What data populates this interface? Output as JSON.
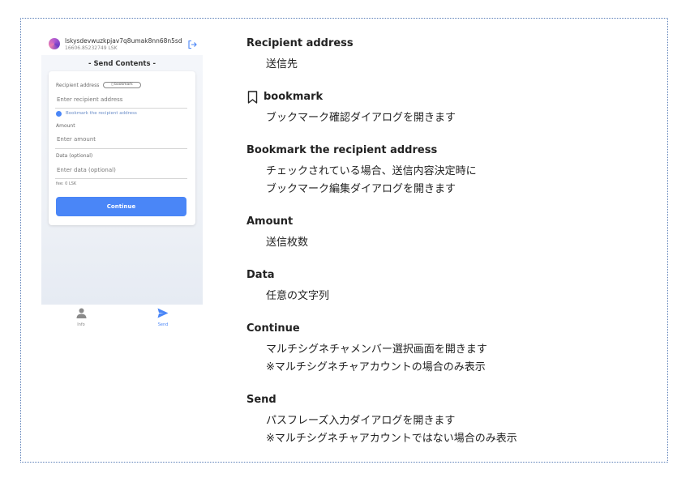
{
  "phone": {
    "address": "lskysdevwuzkpjav7q8umak8nn68n5sd6…",
    "balance": "16606.85232749 LSK",
    "title": "- Send Contents -",
    "recipient_label": "Recipient address",
    "bookmark_pill": "bookmark",
    "recipient_placeholder": "Enter recipient address",
    "bookmark_checkbox_label": "Bookmark the recipient address",
    "amount_label": "Amount",
    "amount_placeholder": "Enter amount",
    "data_label": "Data (optional)",
    "data_placeholder": "Enter data (optional)",
    "fee": "fee: 0 LSK",
    "continue_label": "Continue",
    "nav": [
      {
        "label": "Info",
        "icon": "person-icon",
        "active": false
      },
      {
        "label": "Send",
        "icon": "send-icon",
        "active": true
      }
    ]
  },
  "items": [
    {
      "term": "Recipient address",
      "lines": [
        "送信先"
      ]
    },
    {
      "term": "bookmark",
      "icon": "bookmark-icon",
      "lines": [
        "ブックマーク確認ダイアログを開きます"
      ]
    },
    {
      "term": "Bookmark the recipient address",
      "lines": [
        "チェックされている場合、送信内容決定時に",
        "ブックマーク編集ダイアログを開きます"
      ]
    },
    {
      "term": "Amount",
      "lines": [
        "送信枚数"
      ]
    },
    {
      "term": "Data",
      "lines": [
        "任意の文字列"
      ]
    },
    {
      "term": "Continue",
      "lines": [
        "マルチシグネチャメンバー選択画面を開きます",
        "※マルチシグネチャアカウントの場合のみ表示"
      ]
    },
    {
      "term": "Send",
      "lines": [
        "パスフレーズ入力ダイアログを開きます",
        "※マルチシグネチャアカウントではない場合のみ表示"
      ]
    }
  ],
  "colors": {
    "accent": "#4a86f7",
    "border": "#5b7fb8"
  }
}
